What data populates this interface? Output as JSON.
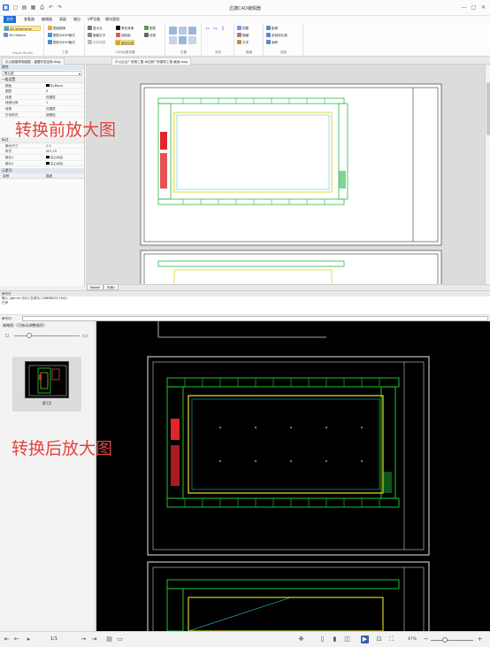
{
  "app": {
    "title": "迅捷CAD编辑器",
    "window_controls": [
      "—",
      "□",
      "✕"
    ]
  },
  "ribbon": {
    "tabs": [
      "文件",
      "查看器",
      "编辑器",
      "高级",
      "输出",
      "VIP功能",
      "模块管理"
    ],
    "active_tab": 0,
    "groups": {
      "visual": {
        "caption": "Visual Styles",
        "items": [
          "2D Wireframe",
          "3D Hidden"
        ]
      },
      "tools": {
        "caption": "工具",
        "items": [
          "图纸图库",
          "图形为EXP格式",
          "图形为EXP格式"
        ]
      },
      "cad_settings": {
        "caption": "CAD绘图设置",
        "items": [
          "显示点",
          "隐藏文字",
          "轮廓调整",
          "黑色背景",
          "调色板",
          "黑白绘图",
          "线宽",
          "图层",
          "图形信息"
        ],
        "selected": "图形信息"
      },
      "position": {
        "caption": "位置"
      },
      "browse": {
        "caption": "浏览"
      },
      "hide": {
        "caption": "隐藏",
        "items": [
          "视图",
          "隐藏",
          "文本"
        ]
      },
      "measure": {
        "caption": "测量",
        "items": [
          "距离",
          "多段线长度",
          "面积"
        ]
      }
    }
  },
  "doc_tabs": [
    "办公楼建筑电路图 - 重要外层出库.dwg",
    "中公企业厂房施工图-N区钢厂房建筑工程-截面.dwg"
  ],
  "properties": {
    "header": "属性",
    "combo_value": "默认层",
    "section_general": "一般设置",
    "rows": [
      {
        "k": "颜色",
        "v": "ByBlock",
        "swatch": true
      },
      {
        "k": "图层",
        "v": "0"
      },
      {
        "k": "线型",
        "v": "仅图层"
      },
      {
        "k": "线型比例",
        "v": "1"
      },
      {
        "k": "线宽",
        "v": "仅图层"
      },
      {
        "k": "打印样式",
        "v": "按颜色"
      }
    ],
    "section_other": "标注",
    "rows2": [
      {
        "k": "箭头尺寸",
        "v": "2.5"
      },
      {
        "k": "样式",
        "v": "ISO-25"
      },
      {
        "k": "箭头1",
        "v": "实心闭合",
        "swatch": true
      },
      {
        "k": "箭头2",
        "v": "实心闭合",
        "swatch": true
      }
    ],
    "layers_header": "元素列",
    "layer_cols": [
      "名称",
      "描述"
    ]
  },
  "layout_tabs": [
    "Model",
    "布局1"
  ],
  "command": {
    "title": "命令行",
    "lines": [
      "输入 (gbmin (64)) 空间为 (166BRLEX (64))",
      "已停"
    ],
    "input_label": "命令行:"
  },
  "thumbnails": {
    "header": "缩略图（可拖动调整顺序）",
    "page_label": "第1页"
  },
  "statusbar": {
    "page": "1/1",
    "zoom": "47%"
  },
  "captions": {
    "before": "转换前放大图",
    "after": "转换后放大图"
  },
  "colors": {
    "accent": "#1f6fd6",
    "caption": "#e0453f",
    "cad_green": "#1fd83a",
    "cad_yellow": "#e8e22a",
    "cad_red": "#e0262a",
    "cad_cyan": "#2ad4e0"
  }
}
